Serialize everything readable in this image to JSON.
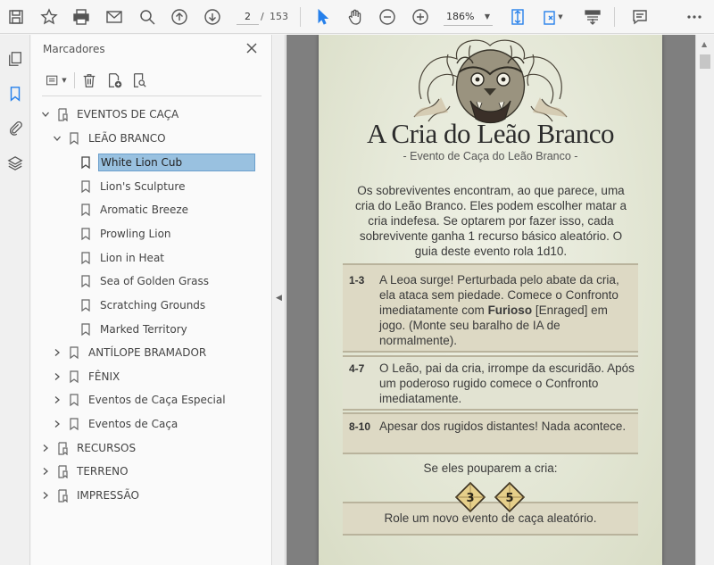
{
  "toolbar": {
    "page_current": "2",
    "page_separator": "/",
    "page_total": "153",
    "zoom_value": "186%"
  },
  "panel": {
    "title": "Marcadores"
  },
  "bookmarks": [
    {
      "label": "EVENTOS DE CAÇA"
    },
    {
      "label": "LEÃO BRANCO"
    },
    {
      "label": "White Lion Cub"
    },
    {
      "label": "Lion's Sculpture"
    },
    {
      "label": "Aromatic Breeze"
    },
    {
      "label": "Prowling Lion"
    },
    {
      "label": "Lion in Heat"
    },
    {
      "label": "Sea of Golden Grass"
    },
    {
      "label": "Scratching Grounds"
    },
    {
      "label": "Marked Territory"
    },
    {
      "label": "ANTÍLOPE BRAMADOR"
    },
    {
      "label": "FÊNIX"
    },
    {
      "label": "Eventos de Caça Especial"
    },
    {
      "label": "Eventos de Caça"
    },
    {
      "label": "RECURSOS"
    },
    {
      "label": "TERRENO"
    },
    {
      "label": "IMPRESSÃO"
    }
  ],
  "document": {
    "title": "A Cria do Leão Branco",
    "subtitle": "- Evento de Caça do Leão Branco -",
    "intro": "Os sobreviventes encontram, ao que parece, uma cria do Leão Branco. Eles podem escolher matar a cria indefesa. Se optarem por fazer isso, cada sobrevivente ganha 1 recurso básico aleatório. O guia deste evento rola 1d10.",
    "events": [
      {
        "range": "1-3",
        "text_before": "A Leoa surge! Perturbada pelo abate da cria, ela ataca sem piedade. Comece o Confronto imediatamente com ",
        "bold": "Furioso",
        "text_after": " [Enraged] em jogo. (Monte seu baralho de IA de normalmente)."
      },
      {
        "range": "4-7",
        "text": "O Leão, pai da cria, irrompe da escuridão. Após um poderoso rugido comece o Confronto imediatamente."
      },
      {
        "range": "8-10",
        "text": "Apesar dos rugidos distantes! Nada acontece."
      }
    ],
    "spare_label": "Se eles pouparem a cria:",
    "dice": [
      "3",
      "5"
    ],
    "reroll_text": "Role um novo evento de caça aleatório."
  }
}
